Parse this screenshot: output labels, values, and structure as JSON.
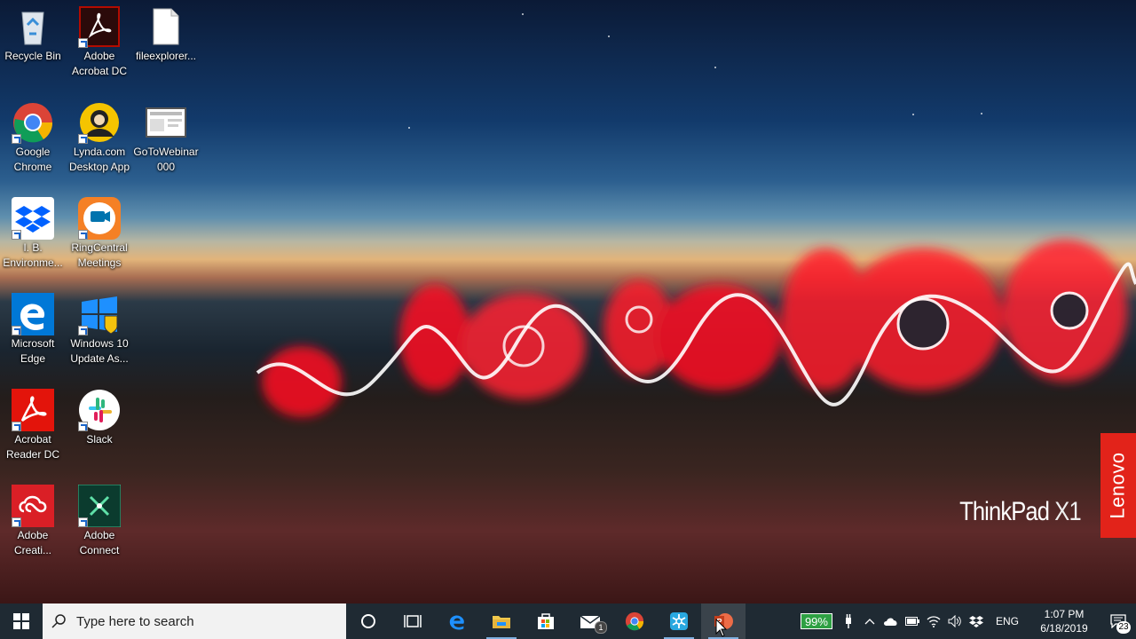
{
  "desktop": {
    "icons": [
      {
        "label": "Recycle Bin",
        "icon": "recycle-bin-icon"
      },
      {
        "label": "Adobe Acrobat DC",
        "icon": "acrobat-icon"
      },
      {
        "label": "fileexplorer...",
        "icon": "document-icon"
      },
      {
        "label": "Google Chrome",
        "icon": "chrome-icon"
      },
      {
        "label": "Lynda.com Desktop App",
        "icon": "lynda-icon"
      },
      {
        "label": "GoToWebinar 000",
        "icon": "gotowebinar-icon"
      },
      {
        "label": "I. B. Environme...",
        "icon": "dropbox-icon"
      },
      {
        "label": "RingCentral Meetings",
        "icon": "ringcentral-icon"
      },
      {
        "label": "Microsoft Edge",
        "icon": "edge-icon"
      },
      {
        "label": "Windows 10 Update As...",
        "icon": "windows-update-icon"
      },
      {
        "label": "Acrobat Reader DC",
        "icon": "acrobat-reader-icon"
      },
      {
        "label": "Slack",
        "icon": "slack-icon"
      },
      {
        "label": "Adobe Creati...",
        "icon": "creative-cloud-icon"
      },
      {
        "label": "Adobe Connect",
        "icon": "adobe-connect-icon"
      }
    ],
    "wallpaper_brand": {
      "thinkpad": "ThinkPad",
      "model": "X1",
      "lenovo": "Lenovo"
    }
  },
  "taskbar": {
    "search_placeholder": "Type here to search",
    "apps": [
      {
        "name": "cortana",
        "icon": "cortana-icon"
      },
      {
        "name": "task-view",
        "icon": "task-view-icon"
      },
      {
        "name": "edge",
        "icon": "edge-icon"
      },
      {
        "name": "file-explorer",
        "icon": "folder-icon"
      },
      {
        "name": "store",
        "icon": "store-icon"
      },
      {
        "name": "mail",
        "icon": "mail-icon",
        "badge": "1"
      },
      {
        "name": "chrome",
        "icon": "chrome-icon"
      },
      {
        "name": "snowflake-app",
        "icon": "snowflake-icon"
      },
      {
        "name": "powerpoint",
        "icon": "powerpoint-icon"
      }
    ],
    "tray": {
      "battery": "99%",
      "language": "ENG",
      "time": "1:07 PM",
      "date": "6/18/2019",
      "notifications": "23"
    }
  },
  "colors": {
    "taskbar": "#1f2a33",
    "battery": "#2ea043",
    "lenovo_red": "#e2231a"
  }
}
